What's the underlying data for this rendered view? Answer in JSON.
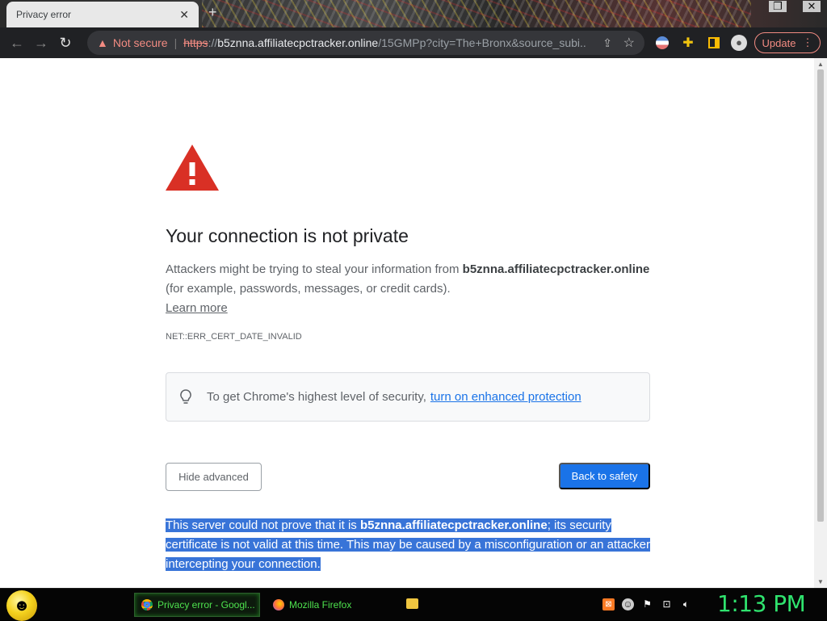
{
  "browser": {
    "tab_title": "Privacy error",
    "tab_close": "✕",
    "new_tab": "+",
    "omnibox": {
      "security_label": "Not secure",
      "url_scheme": "https",
      "url_sep": "://",
      "url_host": "b5znna.affiliatecpctracker.online",
      "url_path": "/15GMPp?city=The+Bronx&source_subi..."
    },
    "update_label": "Update",
    "update_menu": "⋮"
  },
  "interstitial": {
    "heading": "Your connection is not private",
    "explain_pre": "Attackers might be trying to steal your information from ",
    "explain_host": "b5znna.affiliatecpctracker.online",
    "explain_post": " (for example, passwords, messages, or credit cards).",
    "learn_more": "Learn more",
    "error_code": "NET::ERR_CERT_DATE_INVALID",
    "enhanced_text": "To get Chrome's highest level of security,",
    "enhanced_link": "turn on enhanced protection",
    "hide_advanced": "Hide advanced",
    "back_to_safety": "Back to safety",
    "details_pre": "This server could not prove that it is ",
    "details_host": "b5znna.affiliatecpctracker.online",
    "details_post": "; its security certificate is not valid at this time. This may be caused by a misconfiguration or an attacker intercepting your connection."
  },
  "taskbar": {
    "tasks": [
      {
        "label": "Privacy error - Googl...",
        "icon": "chrome-icon"
      },
      {
        "label": "Mozilla Firefox",
        "icon": "firefox-icon"
      }
    ],
    "clock": "1:13 PM"
  },
  "colors": {
    "warning_red": "#d93025",
    "primary_blue": "#1a73e8",
    "selection_blue": "#3874d8",
    "clock_green": "#2fe36e"
  }
}
